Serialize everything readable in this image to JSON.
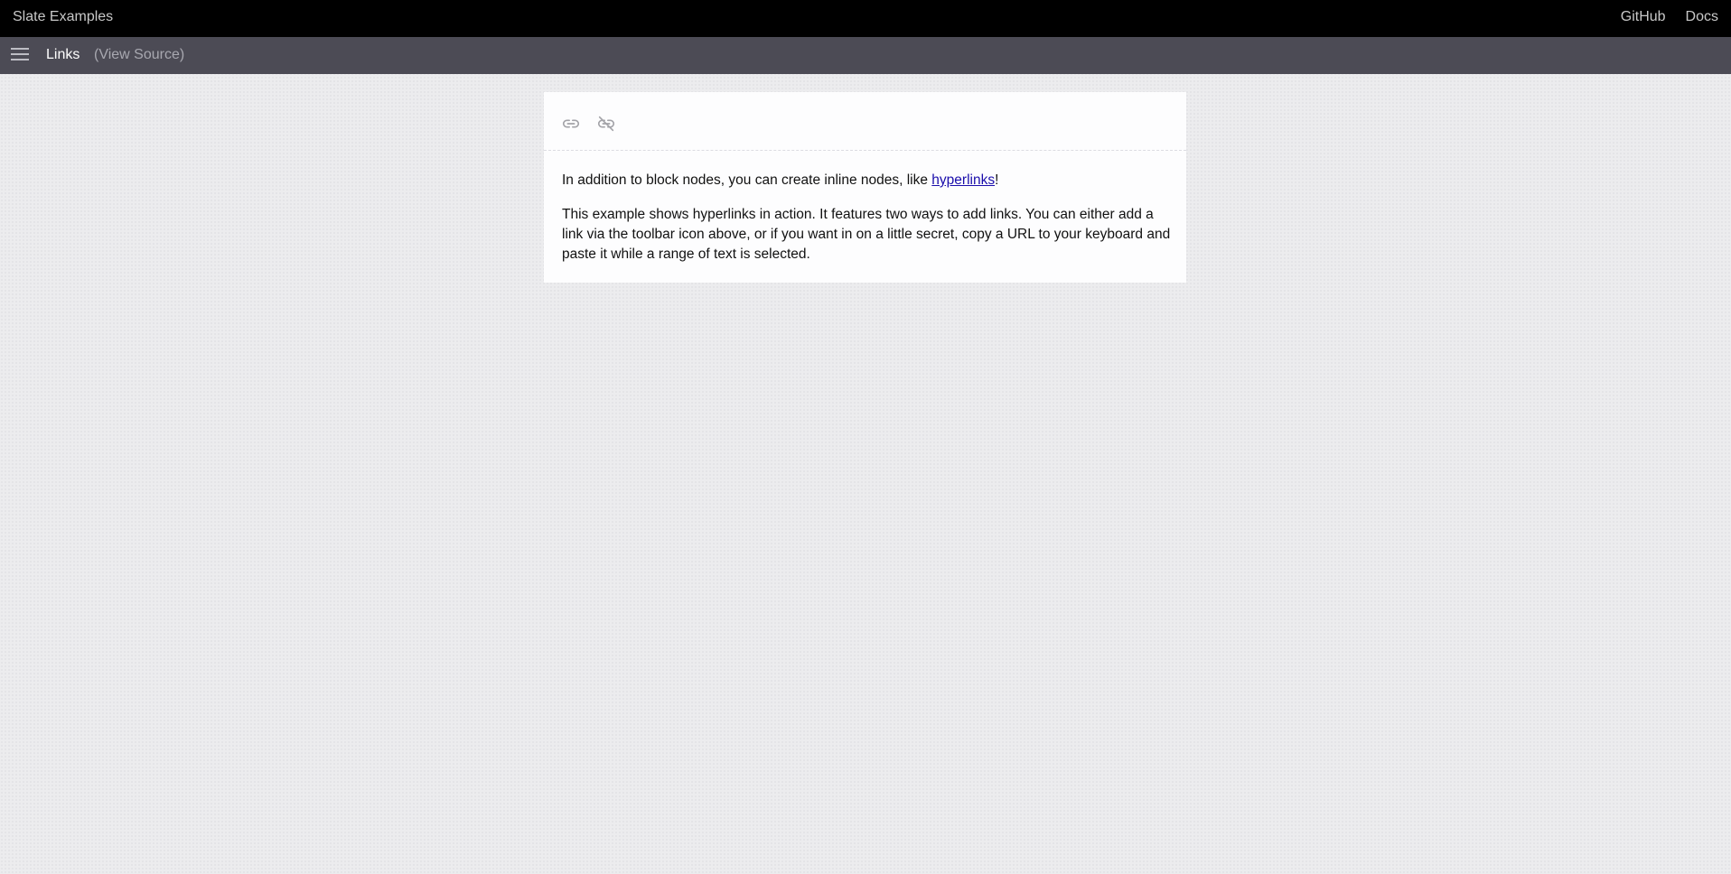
{
  "topbar": {
    "brand": "Slate Examples",
    "links": [
      "GitHub",
      "Docs"
    ]
  },
  "subbar": {
    "menu_icon": "hamburger-menu-icon",
    "title": "Links",
    "view_source": "(View Source)"
  },
  "toolbar": {
    "buttons": [
      {
        "icon": "link-icon"
      },
      {
        "icon": "unlink-icon"
      }
    ]
  },
  "content": {
    "p1_text": "In addition to block nodes, you can create inline nodes, like ",
    "p1_link": "hyperlinks",
    "p1_end": "!",
    "p2": "This example shows hyperlinks in action. It features two ways to add links. You can either add a link via the toolbar icon above, or if you want in on a little secret, copy a URL to your keyboard and paste it while a range of text is selected."
  },
  "colors": {
    "topbar_bg": "#000000",
    "subbar_bg": "#4c4b55",
    "page_bg": "#ececee",
    "link": "#1a0dab"
  }
}
